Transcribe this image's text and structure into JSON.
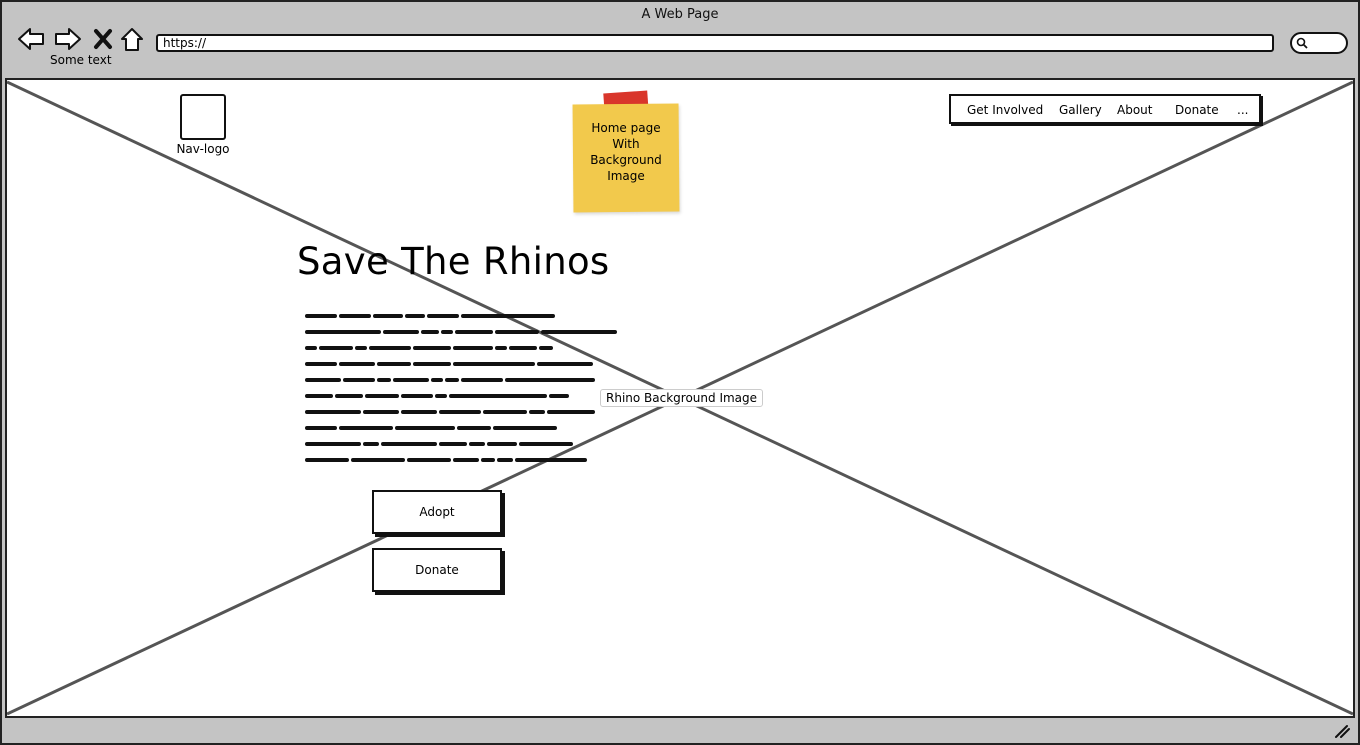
{
  "window": {
    "title": "A Web Page"
  },
  "toolbar": {
    "back_icon": "arrow-left-icon",
    "forward_icon": "arrow-right-icon",
    "stop_icon": "close-icon",
    "home_icon": "home-icon",
    "caption": "Some text",
    "address": "https://",
    "search_icon": "search-icon"
  },
  "page": {
    "logo_label": "Nav-logo",
    "sticky_note": "Home page With Background Image",
    "sticky_lines": [
      "Home page",
      "With",
      "Background",
      "Image"
    ],
    "nav": [
      "Get Involved",
      "Gallery",
      "About",
      "Donate",
      "..."
    ],
    "title": "Save The Rhinos",
    "background_label": "Rhino Background Image",
    "buttons": {
      "adopt": "Adopt",
      "donate": "Donate"
    }
  },
  "colors": {
    "sticky": "#f2c94c",
    "tape": "#d9362b",
    "chrome": "#c4c4c4"
  }
}
